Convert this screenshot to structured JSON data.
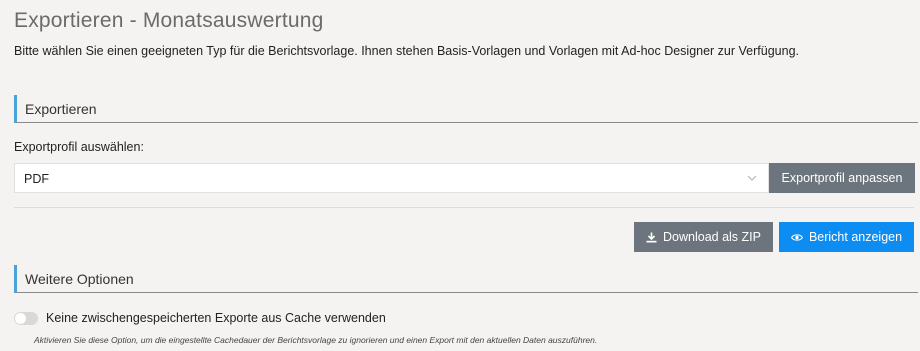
{
  "page": {
    "title": "Exportieren - Monatsauswertung",
    "description": "Bitte wählen Sie einen geeigneten Typ für die Berichtsvorlage. Ihnen stehen Basis-Vorlagen und Vorlagen mit Ad-hoc Designer zur Verfügung."
  },
  "export_section": {
    "title": "Exportieren",
    "profile_label": "Exportprofil auswählen:",
    "profile_value": "PDF",
    "customize_button": "Exportprofil anpassen",
    "download_button": "Download als ZIP",
    "show_report_button": "Bericht anzeigen"
  },
  "more_section": {
    "title": "Weitere Optionen",
    "cache_toggle_label": "Keine zwischengespeicherten Exporte aus Cache verwenden",
    "cache_toggle_state": false,
    "cache_toggle_help": "Aktivieren Sie diese Option, um die eingestellte Cachedauer der Berichtsvorlage zu ignorieren und einen Export mit den aktuellen Daten auszuführen."
  },
  "icons": {
    "select_chevron": "chevron-down-icon",
    "download": "download-icon",
    "eye": "eye-icon"
  },
  "colors": {
    "accent_bar": "#4aa3d8",
    "secondary_button": "#6c757d",
    "primary_button": "#0d8df2",
    "background": "#f4f3f2"
  }
}
